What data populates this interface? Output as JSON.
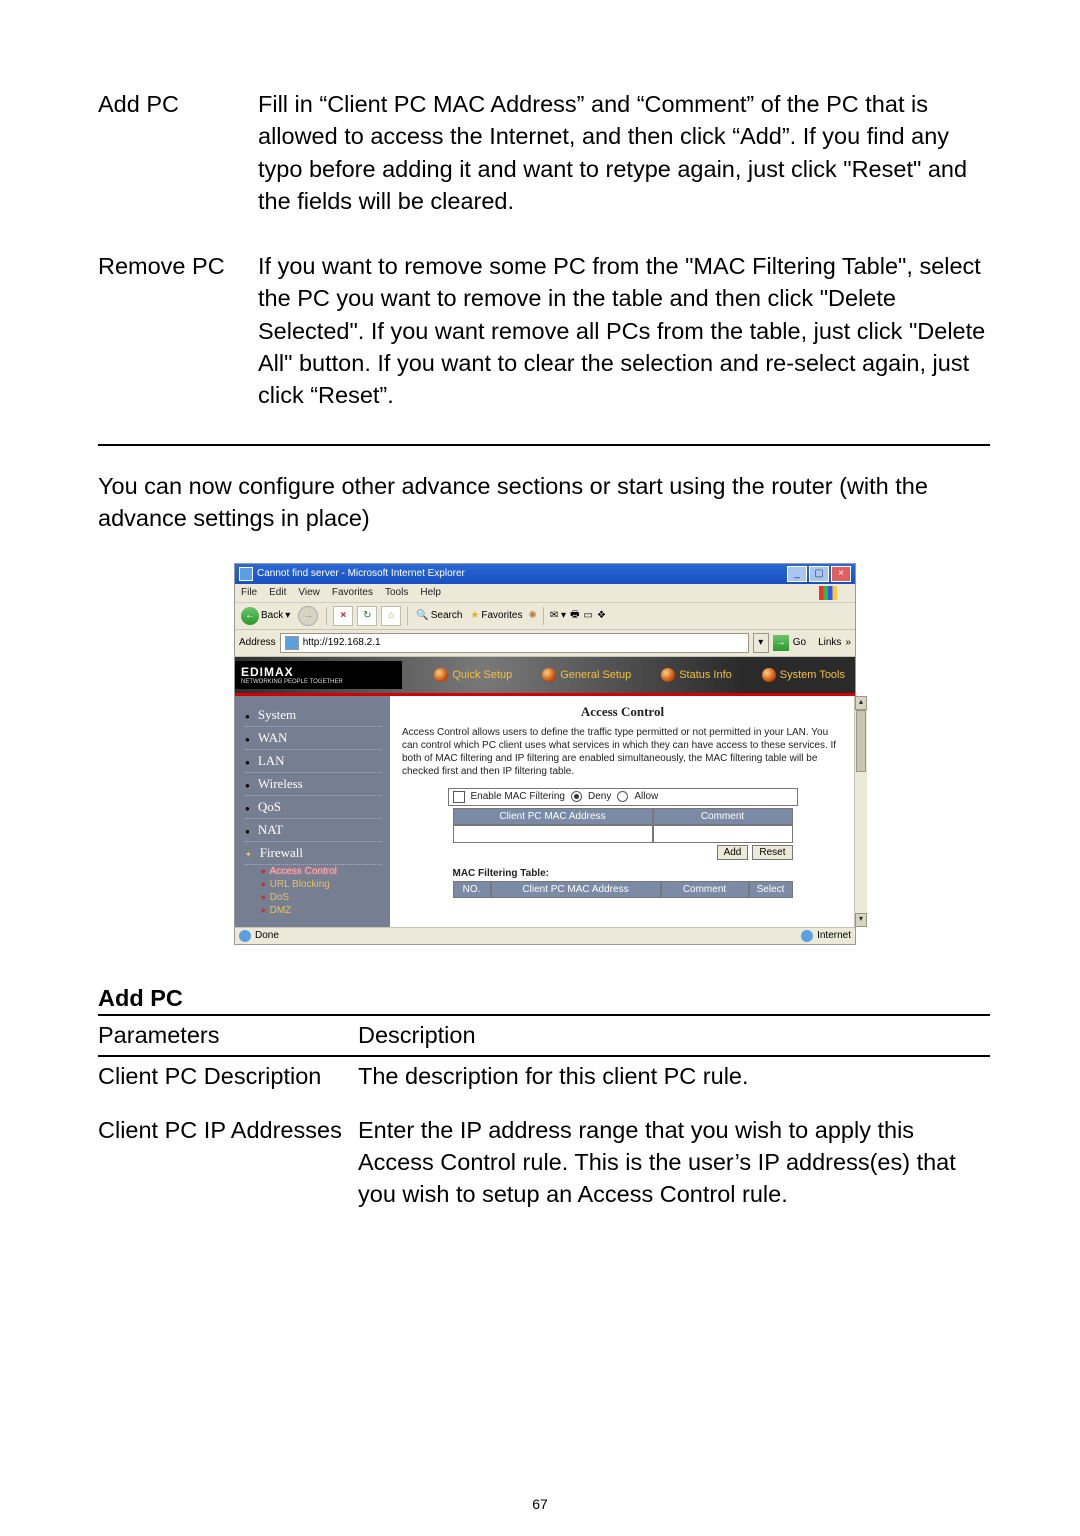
{
  "defs": [
    {
      "label": "Add PC",
      "body": "Fill in “Client PC MAC Address” and “Comment” of the PC that is allowed to access the Internet, and then click “Add”. If you find any typo before adding it and want to retype again, just click \"Reset\" and the fields will be cleared."
    },
    {
      "label": "Remove PC",
      "body": "If you want to remove some PC from the \"MAC Filtering Table\", select the PC you want to remove in the table and then click \"Delete Selected\". If you want remove all PCs from the table, just click \"Delete All\" button. If you want to clear the selection and re-select again, just click “Reset”."
    }
  ],
  "para_after": "You can now configure other advance sections or start using the router (with the advance settings in place)",
  "shot": {
    "title": "Cannot find server - Microsoft Internet Explorer",
    "menus": [
      "File",
      "Edit",
      "View",
      "Favorites",
      "Tools",
      "Help"
    ],
    "back": "Back",
    "search": "Search",
    "favorites": "Favorites",
    "addr_label": "Address",
    "url": "http://192.168.2.1",
    "go": "Go",
    "links": "Links",
    "brand": "EDIMAX",
    "tagline": "NETWORKING PEOPLE TOGETHER",
    "topnav": [
      "Quick Setup",
      "General Setup",
      "Status Info",
      "System Tools"
    ],
    "sidebar": [
      "System",
      "WAN",
      "LAN",
      "Wireless",
      "QoS",
      "NAT",
      "Firewall"
    ],
    "firewall_sub": [
      "Access Control",
      "URL Blocking",
      "DoS",
      "DMZ"
    ],
    "main_heading": "Access Control",
    "main_desc": "Access Control allows users to define the traffic type permitted or not permitted in your LAN. You can control which PC client uses what services in which they can have access to these services.\nIf both of MAC filtering and IP filtering are enabled simultaneously, the MAC filtering table will be checked first and then IP filtering table.",
    "enable_label": "Enable MAC Filtering",
    "deny": "Deny",
    "allow": "Allow",
    "col_mac": "Client PC MAC Address",
    "col_comment": "Comment",
    "btn_add": "Add",
    "btn_reset": "Reset",
    "tbl_label": "MAC Filtering Table:",
    "g2_no": "NO.",
    "g2_mac": "Client PC MAC Address",
    "g2_com": "Comment",
    "g2_sel": "Select",
    "status_done": "Done",
    "status_zone": "Internet"
  },
  "section_title": "Add PC",
  "table_header": {
    "p": "Parameters",
    "d": "Description"
  },
  "rows": [
    {
      "p": "Client PC Description",
      "d": "The description for this client PC rule."
    },
    {
      "p": "Client PC IP Addresses",
      "d": "Enter the IP address range that you wish to apply this Access Control rule. This is the user’s IP address(es) that you wish to setup an Access Control rule."
    }
  ],
  "page_number": "67"
}
